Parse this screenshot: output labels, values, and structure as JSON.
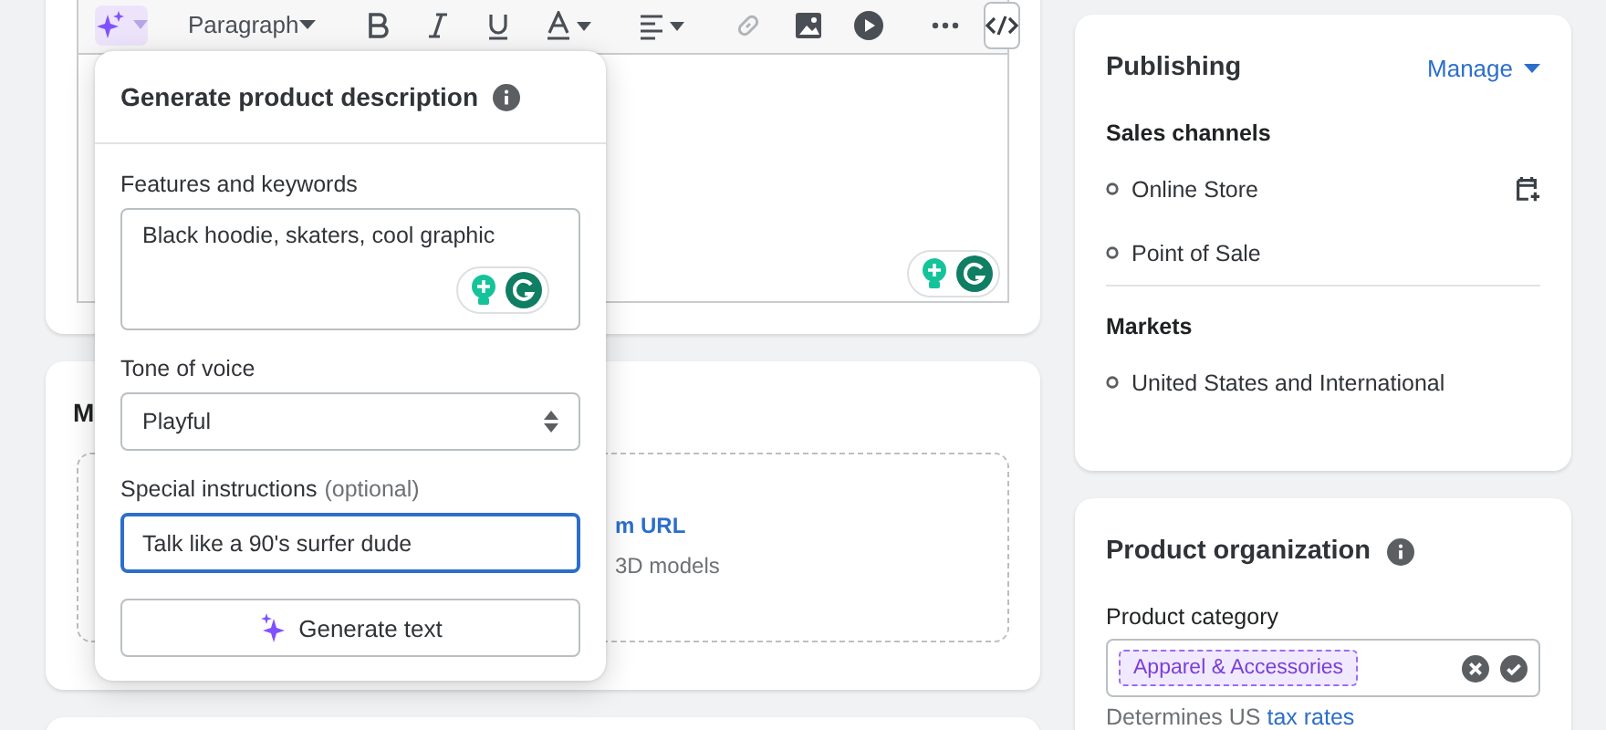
{
  "toolbar": {
    "ai_button": {
      "active": true
    },
    "block_format": "Paragraph"
  },
  "popover": {
    "title": "Generate product description",
    "fields": [
      {
        "kind": "textarea",
        "label": "Features and keywords",
        "value": "Black hoodie, skaters, cool graphic",
        "focused": false
      },
      {
        "kind": "select",
        "label": "Tone of voice",
        "value": "Playful",
        "focused": false
      },
      {
        "kind": "input",
        "label": "Special instructions",
        "optional": "(optional)",
        "value": "Talk like a 90's surfer dude",
        "focused": true
      }
    ],
    "button": "Generate text"
  },
  "media_card": {
    "title_fragment": "M",
    "link_fragment": "m URL",
    "hint_fragment": "3D models"
  },
  "publishing": {
    "title": "Publishing",
    "manage": "Manage",
    "sales_channels_heading": "Sales channels",
    "sales_channels": [
      {
        "name": "Online Store",
        "schedule": true
      },
      {
        "name": "Point of Sale",
        "schedule": false
      }
    ],
    "markets_heading": "Markets",
    "markets": [
      {
        "name": "United States and International"
      }
    ]
  },
  "product_organization": {
    "title": "Product organization",
    "category_label": "Product category",
    "category": "Apparel & Accessories",
    "help_text": "Determines US",
    "help_link": "tax rates"
  }
}
